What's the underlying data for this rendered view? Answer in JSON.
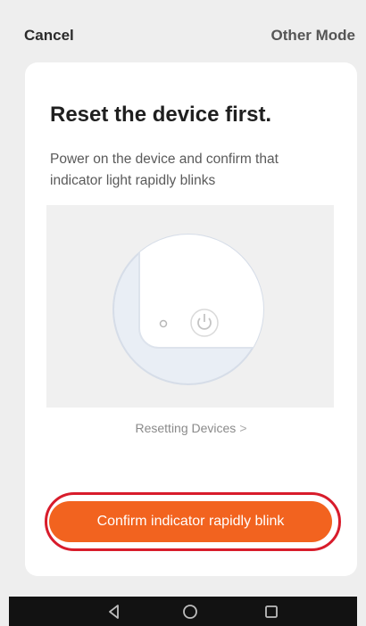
{
  "topbar": {
    "cancel_label": "Cancel",
    "other_mode_label": "Other Mode"
  },
  "card": {
    "title": "Reset the device first.",
    "description": "Power on the device and confirm that indicator light rapidly blinks",
    "illustration_icon": "power-icon",
    "resetting_link": "Resetting Devices",
    "resetting_chevron": ">",
    "confirm_button": "Confirm indicator rapidly blink"
  },
  "navbar": {
    "icons": [
      "back-triangle-icon",
      "home-circle-icon",
      "recents-square-icon"
    ]
  },
  "colors": {
    "accent": "#f2631f",
    "highlight_outline": "#d81c2b",
    "card_bg": "#ffffff",
    "page_bg": "#eeeeee"
  }
}
